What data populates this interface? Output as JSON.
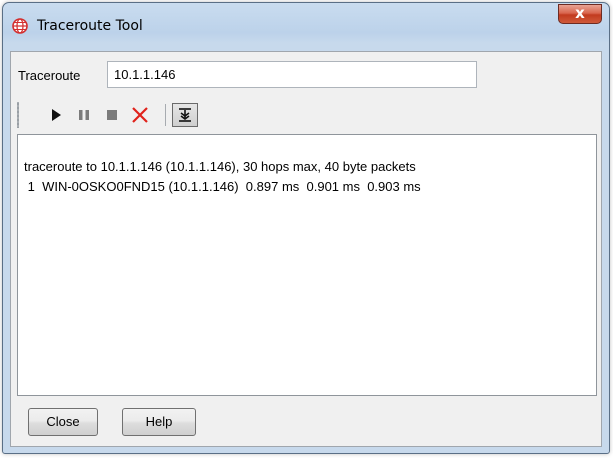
{
  "window": {
    "title": "Traceroute Tool",
    "close_glyph": "x"
  },
  "form": {
    "label": "Traceroute",
    "value": "10.1.1.146"
  },
  "toolbar": {
    "icons": [
      "play-icon",
      "pause-icon",
      "stop-icon",
      "clear-icon",
      "scroll-to-end-icon"
    ]
  },
  "output": {
    "lines": [
      "traceroute to 10.1.1.146 (10.1.1.146), 30 hops max, 40 byte packets",
      " 1  WIN-0OSKO0FND15 (10.1.1.146)  0.897 ms  0.901 ms  0.903 ms"
    ]
  },
  "buttons": {
    "close": "Close",
    "help": "Help"
  },
  "colors": {
    "app_icon": "#d32f2f",
    "stop_x": "#e0231c",
    "close_button": "#c94a30"
  }
}
